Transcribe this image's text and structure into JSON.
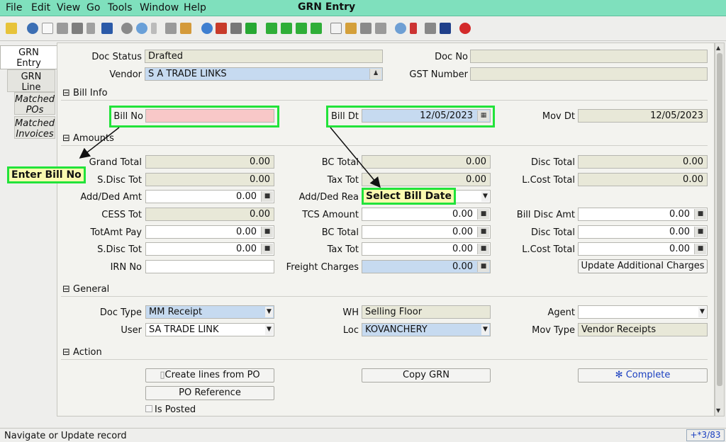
{
  "menubar": {
    "items": [
      "File",
      "Edit",
      "View",
      "Go",
      "Tools",
      "Window",
      "Help"
    ],
    "window_title": "GRN Entry"
  },
  "toolbar": {
    "icons": [
      "undo-icon",
      "help-icon",
      "new-icon",
      "copy-icon",
      "delete-icon",
      "delete-selection-icon",
      "save-icon",
      "refresh-icon",
      "find-icon",
      "attachment-icon",
      "chat-icon",
      "grid-toggle-icon",
      "history-icon",
      "home-icon",
      "back-icon",
      "forward-icon",
      "first-record-icon",
      "previous-record-icon",
      "next-record-icon",
      "last-record-icon",
      "report-icon",
      "archive-icon",
      "print-icon",
      "print-preview-icon",
      "zoom-across-icon",
      "workflow-icon",
      "request-icon",
      "product-info-icon",
      "exit-icon"
    ]
  },
  "tabs": [
    {
      "label": "GRN\nEntry"
    },
    {
      "label": "GRN\nLine"
    },
    {
      "label": "Matched\nPOs"
    },
    {
      "label": "Matched\nInvoices"
    }
  ],
  "header": {
    "doc_status_label": "Doc Status",
    "doc_status_value": "Drafted",
    "doc_no_label": "Doc No",
    "doc_no_value": "",
    "vendor_label": "Vendor",
    "vendor_value": "S A TRADE LINKS",
    "gst_label": "GST Number",
    "gst_value": ""
  },
  "bill_info": {
    "section": "Bill Info",
    "bill_no_label": "Bill No",
    "bill_no_value": "",
    "bill_dt_label": "Bill Dt",
    "bill_dt_value": "12/05/2023",
    "mov_dt_label": "Mov Dt",
    "mov_dt_value": "12/05/2023"
  },
  "amounts": {
    "section": "Amounts",
    "grand_total_label": "Grand Total",
    "grand_total": "0.00",
    "bc_total_label": "BC Total",
    "bc_total": "0.00",
    "disc_total_label": "Disc Total",
    "disc_total": "0.00",
    "sdisc_tot_label": "S.Disc Tot",
    "sdisc_tot": "0.00",
    "tax_tot_label": "Tax Tot",
    "tax_tot": "0.00",
    "lcost_total_label": "L.Cost Total",
    "lcost_total": "0.00",
    "add_ded_amt_label": "Add/Ded Amt",
    "add_ded_amt": "0.00",
    "add_ded_rea_label": "Add/Ded Rea",
    "add_ded_rea": "",
    "cess_tot_label": "CESS Tot",
    "cess_tot": "0.00",
    "tcs_amount_label": "TCS Amount",
    "tcs_amount": "0.00",
    "bill_disc_amt_label": "Bill Disc Amt",
    "bill_disc_amt": "0.00",
    "totamt_pay_label": "TotAmt Pay",
    "totamt_pay": "0.00",
    "bc_total2_label": "BC Total",
    "bc_total2": "0.00",
    "disc_total2_label": "Disc Total",
    "disc_total2": "0.00",
    "sdisc_tot2_label": "S.Disc Tot",
    "sdisc_tot2": "0.00",
    "tax_tot2_label": "Tax Tot",
    "tax_tot2": "0.00",
    "lcost_total2_label": "L.Cost Total",
    "lcost_total2": "0.00",
    "irn_no_label": "IRN No",
    "irn_no": "",
    "freight_label": "Freight Charges",
    "freight": "0.00",
    "update_charges_button": "Update Additional Charges"
  },
  "general": {
    "section": "General",
    "doc_type_label": "Doc Type",
    "doc_type": "MM Receipt",
    "wh_label": "WH",
    "wh": "Selling Floor",
    "agent_label": "Agent",
    "agent": "",
    "user_label": "User",
    "user": "SA TRADE LINK",
    "loc_label": "Loc",
    "loc": "KOVANCHERY",
    "mov_type_label": "Mov Type",
    "mov_type": "Vendor Receipts"
  },
  "action": {
    "section": "Action",
    "create_lines_button": "Create lines from PO",
    "copy_grn_button": "Copy GRN",
    "complete_button": "Complete",
    "po_reference_button": "PO Reference",
    "is_posted_label": "Is Posted"
  },
  "annotations": {
    "enter_bill_no": "Enter Bill No",
    "select_bill_date": "Select Bill Date"
  },
  "status": {
    "text": "Navigate or Update record",
    "record_count": "+*3/83"
  },
  "colors": {
    "menubar": "#7fe0bd",
    "highlight": "#22e33a",
    "mandatory_field": "#f8c8c8",
    "lookup_field": "#c6daf0",
    "readonly_field": "#e8e8d8"
  }
}
